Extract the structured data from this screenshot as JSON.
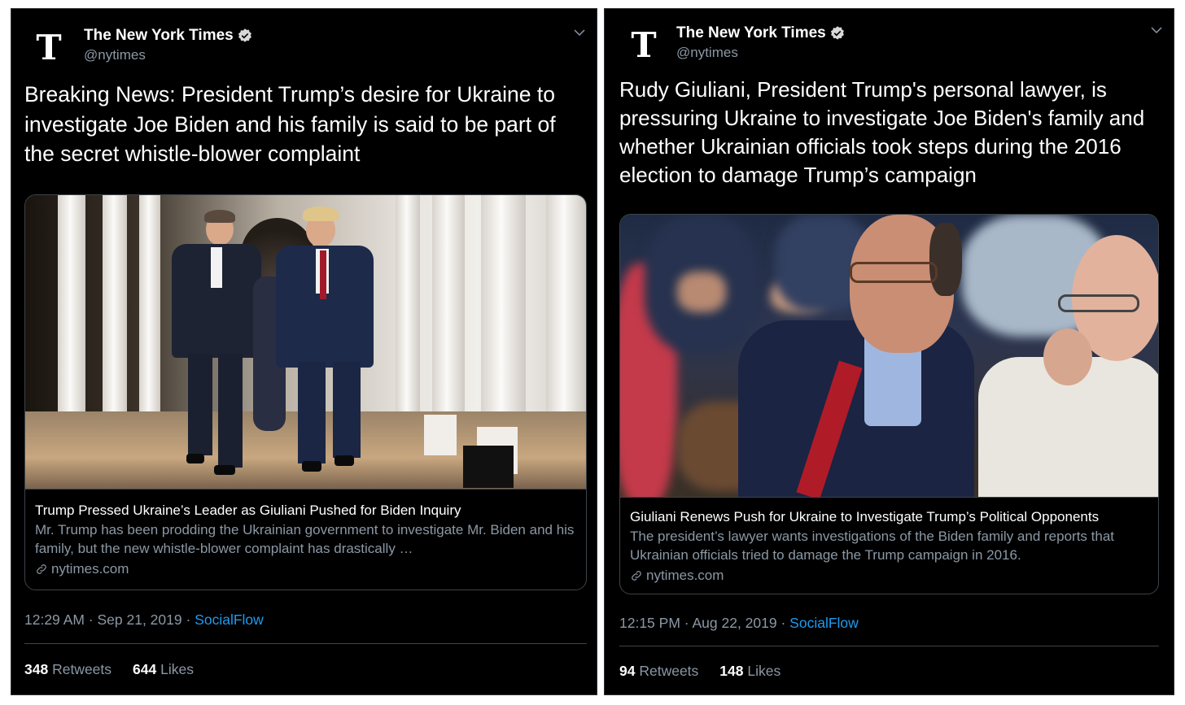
{
  "tweets": [
    {
      "author": {
        "display_name": "The New York Times",
        "handle": "@nytimes",
        "logo_glyph": "T",
        "icon": "verified-badge-icon"
      },
      "text": "Breaking News: President Trump’s desire for Ukraine to investigate Joe Biden and his family is said to be part of the secret whistle-blower complaint",
      "card": {
        "title": "Trump Pressed Ukraine’s Leader as Giuliani Pushed for Biden Inquiry",
        "description": "Mr. Trump has been prodding the Ukrainian government to investigate Mr. Biden and his family, but the new whistle-blower complaint has drastically …",
        "domain": "nytimes.com"
      },
      "timestamp": "12:29 AM · Sep 21, 2019 · ",
      "source": "SocialFlow",
      "retweets_count": "348",
      "retweets_label": "Retweets",
      "likes_count": "644",
      "likes_label": "Likes"
    },
    {
      "author": {
        "display_name": "The New York Times",
        "handle": "@nytimes",
        "logo_glyph": "T",
        "icon": "verified-badge-icon"
      },
      "text": "Rudy Giuliani, President Trump's personal lawyer, is pressuring Ukraine to investigate Joe Biden's family and whether Ukrainian officials took steps during the 2016 election to damage Trump’s campaign",
      "card": {
        "title": "Giuliani Renews Push for Ukraine to Investigate Trump’s Political Opponents",
        "description": "The president’s lawyer wants investigations of the Biden family and reports that Ukrainian officials tried to damage the Trump campaign in 2016.",
        "domain": "nytimes.com"
      },
      "timestamp": "12:15 PM · Aug 22, 2019 · ",
      "source": "SocialFlow",
      "retweets_count": "94",
      "retweets_label": "Retweets",
      "likes_count": "148",
      "likes_label": "Likes"
    }
  ],
  "colors": {
    "background": "#000000",
    "text": "#ffffff",
    "muted": "#8b98a5",
    "link": "#1d9bf0",
    "border": "#3d4449"
  }
}
